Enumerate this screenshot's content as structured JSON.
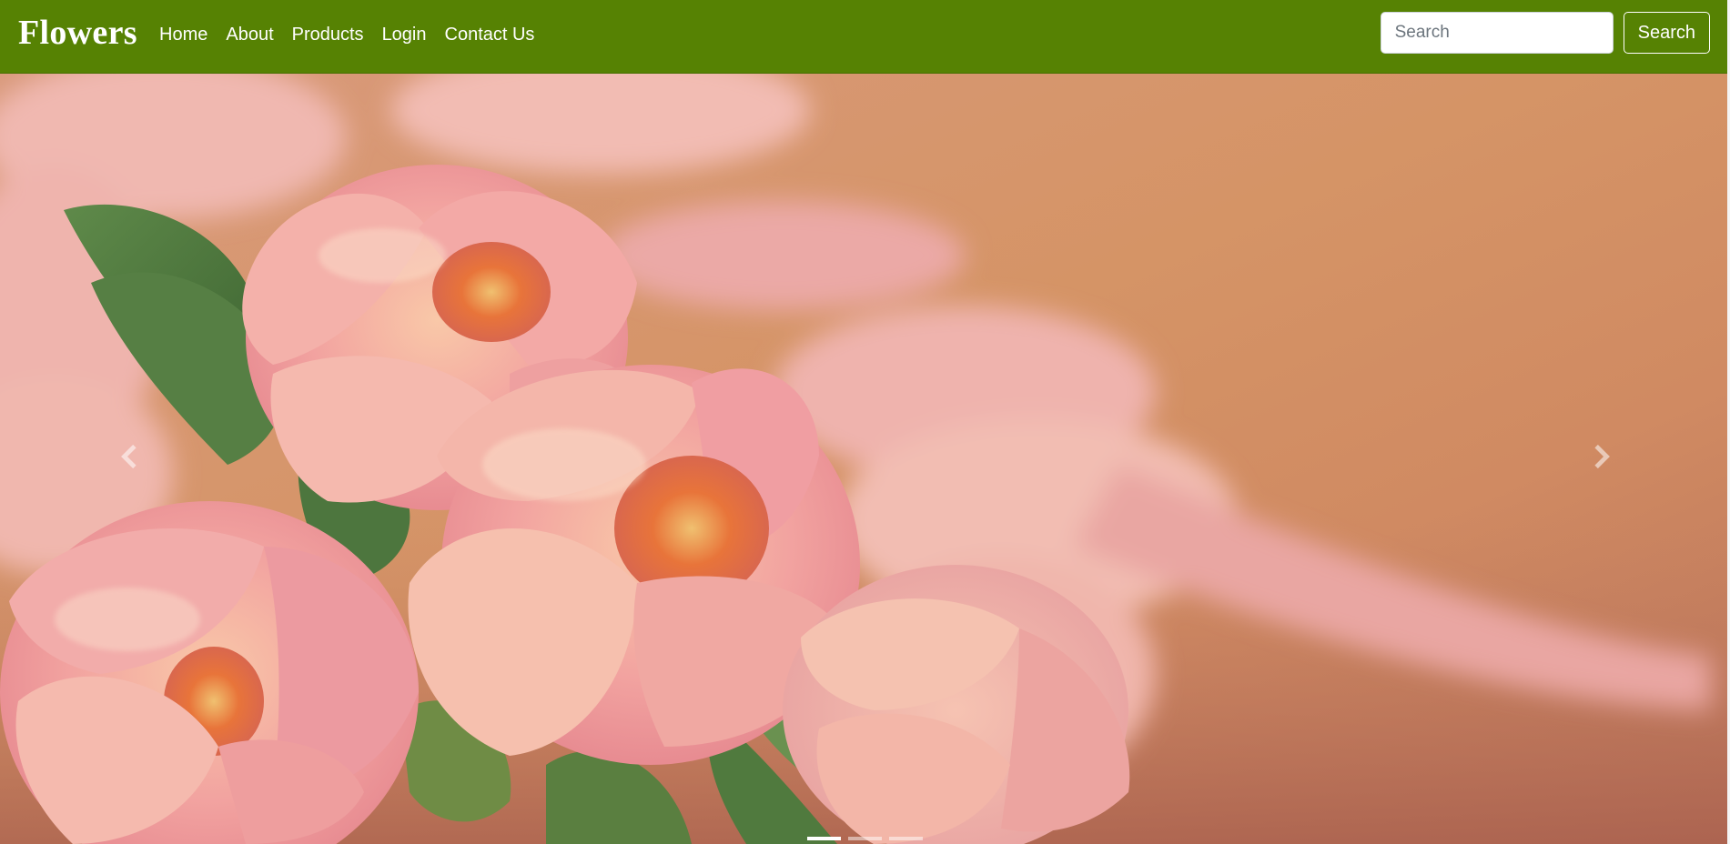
{
  "navbar": {
    "brand": "Flowers",
    "links": [
      {
        "label": "Home"
      },
      {
        "label": "About"
      },
      {
        "label": "Products"
      },
      {
        "label": "Login"
      },
      {
        "label": "Contact Us"
      }
    ],
    "search": {
      "placeholder": "Search",
      "value": "",
      "button_label": "Search"
    }
  },
  "carousel": {
    "slide_description_icon": "pink-tulips-photo",
    "prev_icon": "chevron-left-icon",
    "next_icon": "chevron-right-icon",
    "indicator_count": 3,
    "active_index": 0
  },
  "colors": {
    "navbar_bg": "#568203",
    "nav_text": "#ffffff"
  }
}
